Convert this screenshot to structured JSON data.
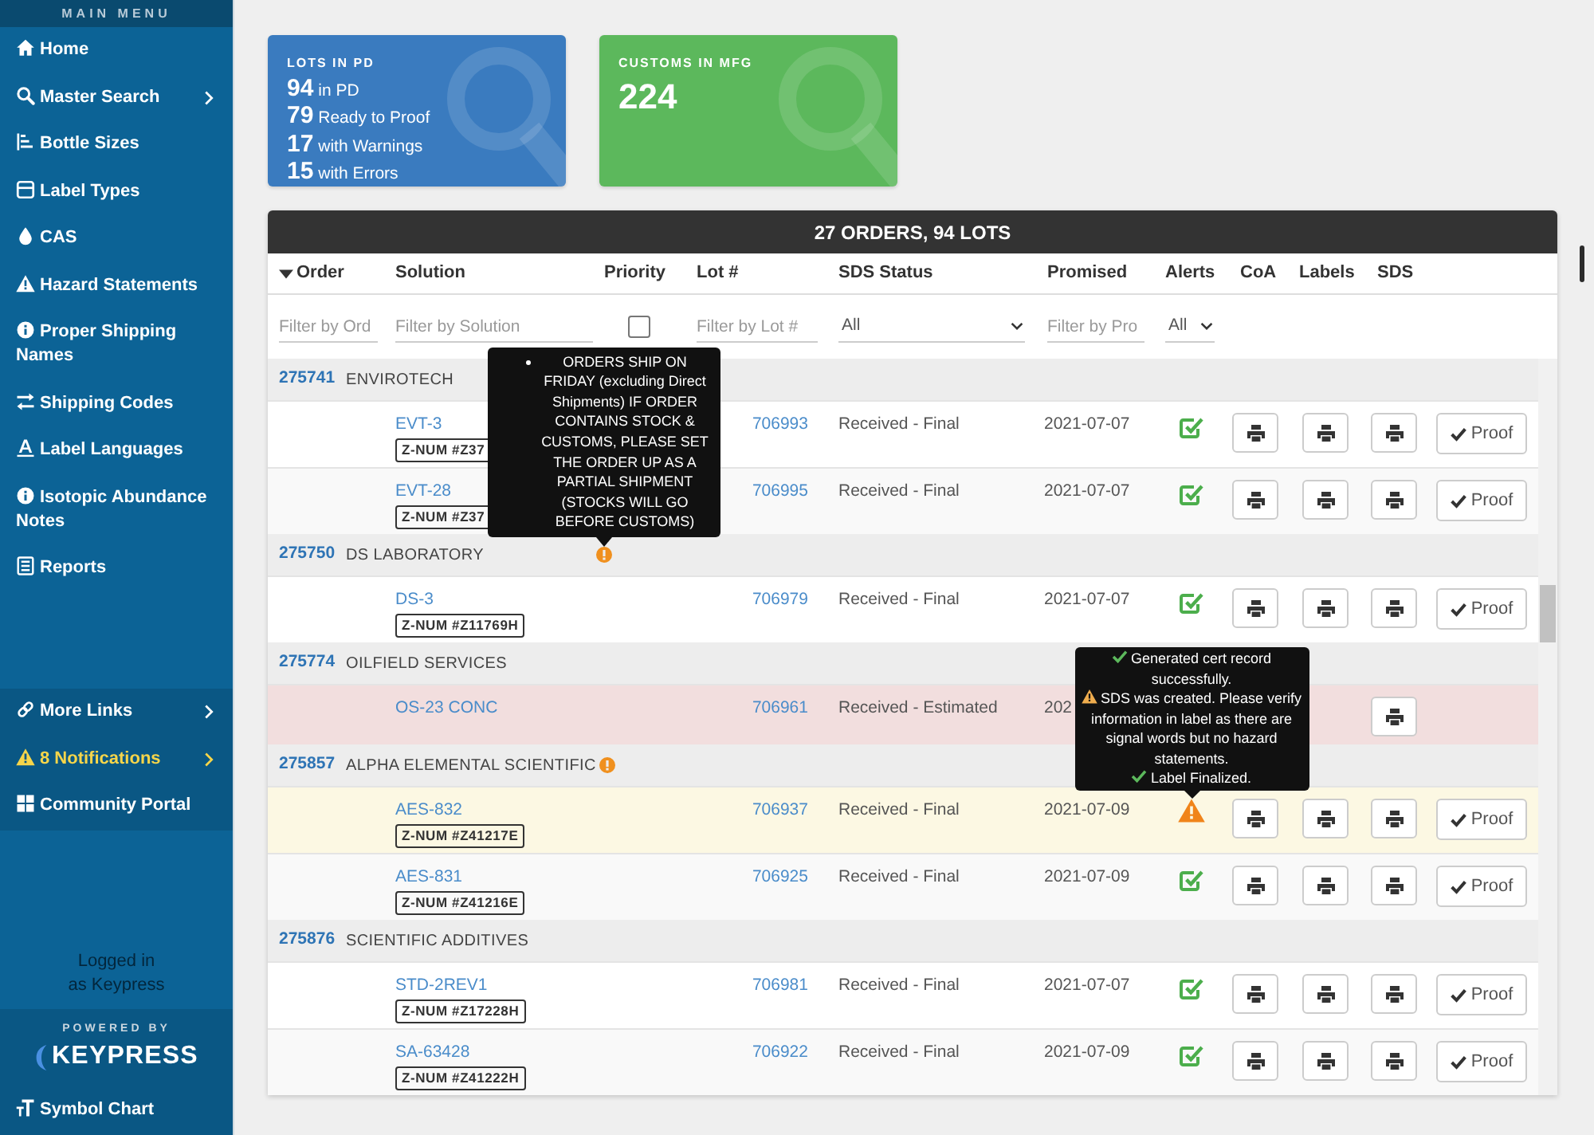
{
  "sidebar": {
    "title": "MAIN MENU",
    "items": [
      {
        "label": "Home",
        "has_submenu": false
      },
      {
        "label": "Master Search",
        "has_submenu": true
      },
      {
        "label": "Bottle Sizes",
        "has_submenu": false
      },
      {
        "label": "Label Types",
        "has_submenu": false
      },
      {
        "label": "CAS",
        "has_submenu": false
      },
      {
        "label": "Hazard Statements",
        "has_submenu": false
      },
      {
        "label": "Proper Shipping Names",
        "has_submenu": false
      },
      {
        "label": "Shipping Codes",
        "has_submenu": false
      },
      {
        "label": "Label Languages",
        "has_submenu": false
      },
      {
        "label": "Isotopic Abundance Notes",
        "has_submenu": false
      },
      {
        "label": "Reports",
        "has_submenu": false
      }
    ],
    "secondary_items": [
      {
        "label": "More Links",
        "has_submenu": true,
        "highlighted": false
      },
      {
        "label": "8 Notifications",
        "has_submenu": true,
        "highlighted": true
      },
      {
        "label": "Community Portal",
        "has_submenu": false,
        "highlighted": false
      }
    ],
    "login_note": [
      "Logged in",
      "as Keypress"
    ],
    "powered_by": "POWERED BY",
    "brand": "KEYPRESS",
    "footer_link": "Symbol Chart"
  },
  "cards": [
    {
      "kind": "breakdown",
      "title": "LOTS IN PD",
      "color": "#3a7bbf",
      "lines": [
        "**94** in PD",
        "**79** Ready to Proof",
        "**17** with Warnings",
        "**15** with Errors"
      ]
    },
    {
      "kind": "total",
      "title": "CUSTOMS IN MFG",
      "color": "#5cb85c",
      "value": "224"
    }
  ],
  "orders_table": {
    "title": "27 ORDERS, 94 LOTS",
    "columns": [
      {
        "label": "Order",
        "sorted": true
      },
      {
        "label": "Solution",
        "sorted": false
      },
      {
        "label": "Priority",
        "sorted": false
      },
      {
        "label": "Lot #",
        "sorted": false
      },
      {
        "label": "SDS Status",
        "sorted": false
      },
      {
        "label": "Promised",
        "sorted": false
      },
      {
        "label": "Alerts",
        "sorted": false
      },
      {
        "label": "CoA",
        "sorted": false
      },
      {
        "label": "Labels",
        "sorted": false
      },
      {
        "label": "SDS",
        "sorted": false
      }
    ],
    "filters": [
      {
        "kind": "text",
        "placeholder": "Filter by Ord"
      },
      {
        "kind": "text",
        "placeholder": "Filter by Solution"
      },
      {
        "kind": "checkbox",
        "checked": false
      },
      {
        "kind": "text",
        "placeholder": "Filter by Lot #"
      },
      {
        "kind": "select",
        "value": "All"
      },
      {
        "kind": "text",
        "placeholder": "Filter by Pro"
      },
      {
        "kind": "select",
        "value": "All"
      }
    ],
    "groups": [
      {
        "order": "275741",
        "customer": "ENVIROTECH",
        "priority": false,
        "lots": [
          {
            "solution": "EVT-3",
            "z_number": "Z-NUM #Z37",
            "lot": "706993",
            "sds_status": "Received - Final",
            "promised": "2021-07-07",
            "alert_warning": false,
            "coa": true,
            "labels": true,
            "sds": true,
            "proof": "Proof",
            "has_error": false
          },
          {
            "solution": "EVT-28",
            "z_number": "Z-NUM #Z37",
            "lot": "706995",
            "sds_status": "Received - Final",
            "promised": "2021-07-07",
            "alert_warning": false,
            "coa": true,
            "labels": true,
            "sds": true,
            "proof": "Proof",
            "has_error": false
          }
        ]
      },
      {
        "order": "275750",
        "customer": "DS LABORATORY",
        "priority": true,
        "priority_tooltip": "ORDERS SHIP ON FRIDAY (excluding Direct Shipments) IF ORDER CONTAINS STOCK & CUSTOMS, PLEASE SET THE ORDER UP AS A PARTIAL SHIPMENT (STOCKS WILL GO BEFORE CUSTOMS)",
        "lots": [
          {
            "solution": "DS-3",
            "z_number": "Z-NUM #Z11769H",
            "lot": "706979",
            "sds_status": "Received - Final",
            "promised": "2021-07-07",
            "alert_warning": false,
            "coa": true,
            "labels": true,
            "sds": true,
            "proof": "Proof",
            "has_error": false
          }
        ]
      },
      {
        "order": "275774",
        "customer": "OILFIELD SERVICES",
        "priority": false,
        "lots": [
          {
            "solution": "OS-23 CONC",
            "lot": "706961",
            "sds_status": "Received - Estimated",
            "promised": "202",
            "coa": false,
            "labels": false,
            "sds": true,
            "has_error": true
          }
        ]
      },
      {
        "order": "275857",
        "customer": "ALPHA ELEMENTAL SCIENTIFIC",
        "priority": true,
        "lots": [
          {
            "solution": "AES-832",
            "z_number": "Z-NUM #Z41217E",
            "lot": "706937",
            "sds_status": "Received - Final",
            "promised": "2021-07-09",
            "alert_warning": true,
            "alert_tooltip": [
              {
                "kind": "success",
                "text": "Generated cert record successfully."
              },
              {
                "kind": "warning",
                "text": "SDS was created. Please verify information in label as there are signal words but no hazard statements."
              },
              {
                "kind": "success",
                "text": "Label Finalized."
              }
            ],
            "coa": true,
            "labels": true,
            "sds": true,
            "proof": "Proof",
            "has_error": false
          },
          {
            "solution": "AES-831",
            "z_number": "Z-NUM #Z41216E",
            "lot": "706925",
            "sds_status": "Received - Final",
            "promised": "2021-07-09",
            "alert_warning": false,
            "coa": true,
            "labels": true,
            "sds": true,
            "proof": "Proof",
            "has_error": false
          }
        ]
      },
      {
        "order": "275876",
        "customer": "SCIENTIFIC ADDITIVES",
        "priority": false,
        "lots": [
          {
            "solution": "STD-2REV1",
            "z_number": "Z-NUM #Z17228H",
            "lot": "706981",
            "sds_status": "Received - Final",
            "promised": "2021-07-07",
            "alert_warning": false,
            "coa": true,
            "labels": true,
            "sds": true,
            "proof": "Proof",
            "has_error": false
          },
          {
            "solution": "SA-63428",
            "z_number": "Z-NUM #Z41222H",
            "lot": "706922",
            "sds_status": "Received - Final",
            "promised": "2021-07-09",
            "alert_warning": false,
            "coa": true,
            "labels": true,
            "sds": true,
            "proof": "Proof",
            "has_error": false
          }
        ]
      }
    ]
  }
}
